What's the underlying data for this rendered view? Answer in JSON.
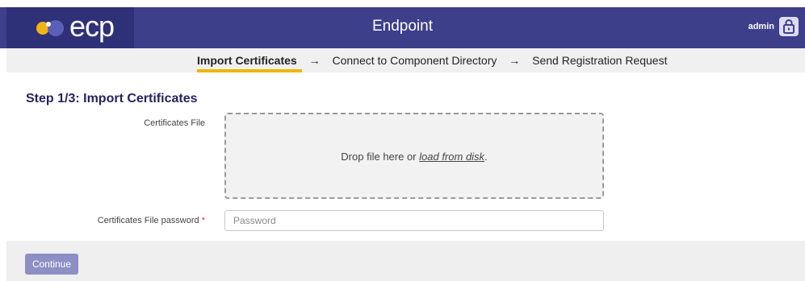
{
  "header": {
    "logo_text": "ecp",
    "title": "Endpoint",
    "user": "admin",
    "lock_icon": "lock-icon"
  },
  "wizard": {
    "steps": [
      {
        "label": "Import Certificates",
        "active": true
      },
      {
        "label": "Connect to Component Directory",
        "active": false
      },
      {
        "label": "Send Registration Request",
        "active": false
      }
    ],
    "arrow": "→"
  },
  "form": {
    "title": "Step 1/3: Import Certificates",
    "file_label": "Certificates File",
    "drop_text": "Drop file here or",
    "drop_link": "load from disk",
    "drop_suffix": ".",
    "password_label": "Certificates File password",
    "required_mark": "*",
    "password_placeholder": "Password"
  },
  "footer": {
    "continue_label": "Continue"
  },
  "colors": {
    "header_bg": "#3d3f8a",
    "accent_underline": "#f0b400",
    "button_bg": "#8e8fc4"
  }
}
